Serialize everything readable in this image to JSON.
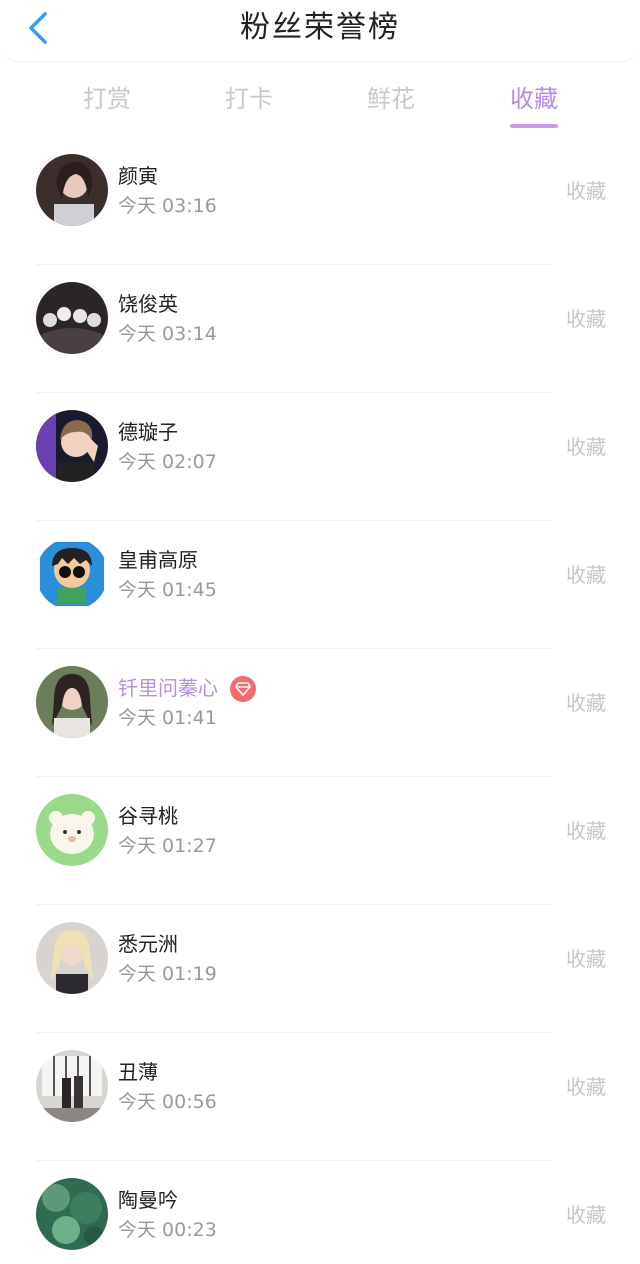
{
  "header": {
    "title": "粉丝荣誉榜",
    "back_icon": "chevron-left-icon",
    "accent_color": "#3a9cf2"
  },
  "tabs": [
    {
      "label": "打赏",
      "active": false
    },
    {
      "label": "打卡",
      "active": false
    },
    {
      "label": "鲜花",
      "active": false
    },
    {
      "label": "收藏",
      "active": true
    }
  ],
  "active_color": "#b88be0",
  "fans": [
    {
      "name": "颜寅",
      "time": "今天 03:16",
      "action": "收藏",
      "vip": false,
      "avatar": "girl-photo"
    },
    {
      "name": "饶俊英",
      "time": "今天 03:14",
      "action": "收藏",
      "vip": false,
      "avatar": "group-photo"
    },
    {
      "name": "德璇子",
      "time": "今天 02:07",
      "action": "收藏",
      "vip": false,
      "avatar": "boy-photo"
    },
    {
      "name": "皇甫高原",
      "time": "今天 01:45",
      "action": "收藏",
      "vip": false,
      "avatar": "cartoon-boy"
    },
    {
      "name": "钎里问蓁心",
      "time": "今天 01:41",
      "action": "收藏",
      "vip": true,
      "avatar": "girl-photo"
    },
    {
      "name": "谷寻桃",
      "time": "今天 01:27",
      "action": "收藏",
      "vip": false,
      "avatar": "cartoon-bear"
    },
    {
      "name": "悉元洲",
      "time": "今天 01:19",
      "action": "收藏",
      "vip": false,
      "avatar": "girl-photo"
    },
    {
      "name": "丑薄",
      "time": "今天 00:56",
      "action": "收藏",
      "vip": false,
      "avatar": "couple-photo"
    },
    {
      "name": "陶曼吟",
      "time": "今天 00:23",
      "action": "收藏",
      "vip": false,
      "avatar": "nature-photo"
    }
  ]
}
